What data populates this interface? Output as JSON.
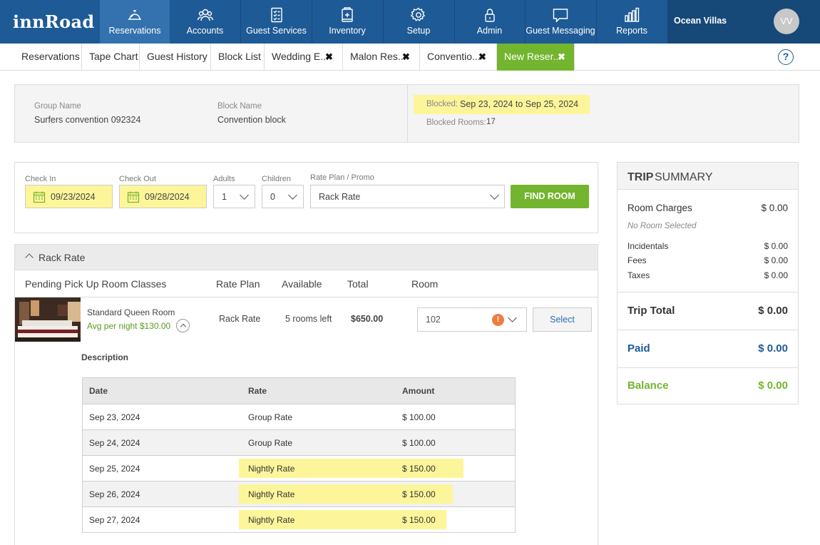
{
  "brand": {
    "logo": "innRoad"
  },
  "nav": {
    "items": [
      {
        "label": "Reservations",
        "icon": "bell-icon"
      },
      {
        "label": "Accounts",
        "icon": "users-icon"
      },
      {
        "label": "Guest Services",
        "icon": "checklist-icon"
      },
      {
        "label": "Inventory",
        "icon": "inventory-icon"
      },
      {
        "label": "Setup",
        "icon": "gear-icon"
      },
      {
        "label": "Admin",
        "icon": "lock-icon"
      },
      {
        "label": "Guest Messaging",
        "icon": "message-icon"
      },
      {
        "label": "Reports",
        "icon": "bar-chart-icon"
      }
    ],
    "property": "Ocean Villas",
    "avatar": "VV"
  },
  "tabs": [
    {
      "label": "Reservations"
    },
    {
      "label": "Tape Chart"
    },
    {
      "label": "Guest History"
    },
    {
      "label": "Block List"
    },
    {
      "label": "Wedding E..."
    },
    {
      "label": "Malon Res..."
    },
    {
      "label": "Conventio..."
    },
    {
      "label": "New Reser..."
    }
  ],
  "group": {
    "group_name_label": "Group Name",
    "group_name": "Surfers convention 092324",
    "block_name_label": "Block Name",
    "block_name": "Convention block",
    "blocked_label": "Blocked:",
    "blocked_value": "Sep 23, 2024 to Sep 25, 2024",
    "blocked_rooms_label": "Blocked Rooms:",
    "blocked_rooms": "17"
  },
  "search": {
    "checkin_label": "Check In",
    "checkin": "09/23/2024",
    "checkout_label": "Check Out",
    "checkout": "09/28/2024",
    "adults_label": "Adults",
    "adults": "1",
    "children_label": "Children",
    "children": "0",
    "rateplan_label": "Rate Plan / Promo",
    "rateplan": "Rack Rate",
    "find_button": "FIND ROOM"
  },
  "rates": {
    "section_title": "Rack Rate",
    "columns": {
      "classes": "Pending Pick Up Room Classes",
      "rate_plan": "Rate Plan",
      "available": "Available",
      "total": "Total",
      "room": "Room"
    },
    "room": {
      "name": "Standard Queen Room",
      "avg": "Avg per night $130.00",
      "rate_plan": "Rack Rate",
      "available": "5 rooms left",
      "total": "$650.00",
      "room_number": "102",
      "select_button": "Select"
    },
    "description_label": "Description",
    "table": {
      "headers": {
        "date": "Date",
        "rate": "Rate",
        "amount": "Amount"
      },
      "rows": [
        {
          "date": "Sep 23, 2024",
          "rate": "Group Rate",
          "amount": "$ 100.00"
        },
        {
          "date": "Sep 24, 2024",
          "rate": "Group Rate",
          "amount": "$ 100.00"
        },
        {
          "date": "Sep 25, 2024",
          "rate": "Nightly Rate",
          "amount": "$ 150.00"
        },
        {
          "date": "Sep 26, 2024",
          "rate": "Nightly Rate",
          "amount": "$ 150.00"
        },
        {
          "date": "Sep 27, 2024",
          "rate": "Nightly Rate",
          "amount": "$ 150.00"
        }
      ]
    }
  },
  "trip": {
    "title_bold": "TRIP",
    "title_rest": "SUMMARY",
    "room_charges_label": "Room Charges",
    "room_charges": "$ 0.00",
    "no_room": "No Room Selected",
    "incidentals_label": "Incidentals",
    "incidentals": "$ 0.00",
    "fees_label": "Fees",
    "fees": "$ 0.00",
    "taxes_label": "Taxes",
    "taxes": "$ 0.00",
    "trip_total_label": "Trip Total",
    "trip_total": "$ 0.00",
    "paid_label": "Paid",
    "paid": "$ 0.00",
    "balance_label": "Balance",
    "balance": "$ 0.00"
  },
  "colors": {
    "nav_bg": "#1e5a96",
    "nav_active": "#3372ae",
    "accent_green": "#73b52e",
    "highlight_yellow": "#fdf59a",
    "link_blue": "#2d6fb0"
  }
}
